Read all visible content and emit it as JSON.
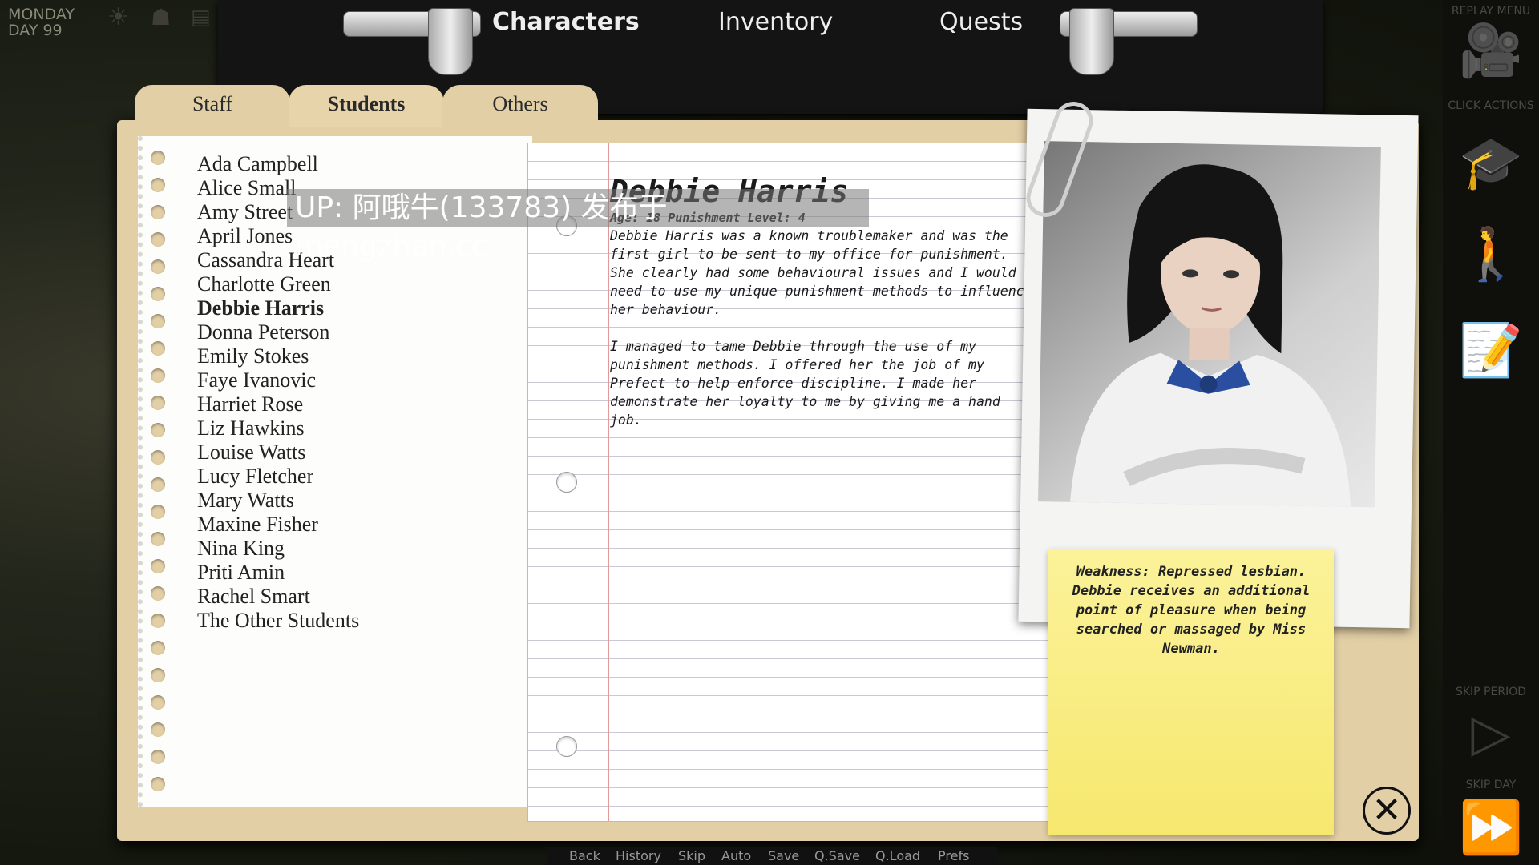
{
  "status": {
    "day_name": "MONDAY",
    "day_number": "DAY 99"
  },
  "top_tabs": [
    "Characters",
    "Inventory",
    "Quests"
  ],
  "folder_tabs": [
    "Staff",
    "Students",
    "Others"
  ],
  "students": [
    "Ada Campbell",
    "Alice Small",
    "Amy Street",
    "April Jones",
    "Cassandra Heart",
    "Charlotte Green",
    "Debbie Harris",
    "Donna Peterson",
    "Emily Stokes",
    "Faye Ivanovic",
    "Harriet Rose",
    "Liz Hawkins",
    "Louise Watts",
    "Lucy Fletcher",
    "Mary Watts",
    "Maxine Fisher",
    "Nina King",
    "Priti Amin",
    "Rachel Smart",
    "The Other Students"
  ],
  "selected": {
    "name": "Debbie Harris",
    "meta": "Age: 18   Punishment Level: 4",
    "paragraph1": "Debbie Harris was a known troublemaker and was the first girl to be sent to my office for punishment. She clearly had some behavioural issues and I would need to use my unique punishment methods to influence her behaviour.",
    "paragraph2": "I managed to tame Debbie through the use of my punishment methods. I offered her the job of my Prefect to help enforce discipline. I made her demonstrate her loyalty to me by giving me a hand job.",
    "weakness": "Weakness: Repressed lesbian. Debbie receives an additional point of pleasure when being searched or massaged by Miss Newman."
  },
  "right_panel": {
    "replay": "REPLAY MENU",
    "click_actions": "CLICK ACTIONS",
    "skip_period": "SKIP PERIOD",
    "skip_day": "SKIP DAY"
  },
  "watermark": "UP: 阿哦牛(133783) 发布于 mengzhan.cc",
  "bottom_nav": [
    "Back",
    "History",
    "Skip",
    "Auto",
    "Save",
    "Q.Save",
    "Q.Load",
    "Prefs"
  ],
  "close_icon": "close-circle-icon",
  "colors": {
    "folder": "#e2cfa6",
    "sticky": "#f8ec7a",
    "margin_line": "#e39a9a"
  }
}
